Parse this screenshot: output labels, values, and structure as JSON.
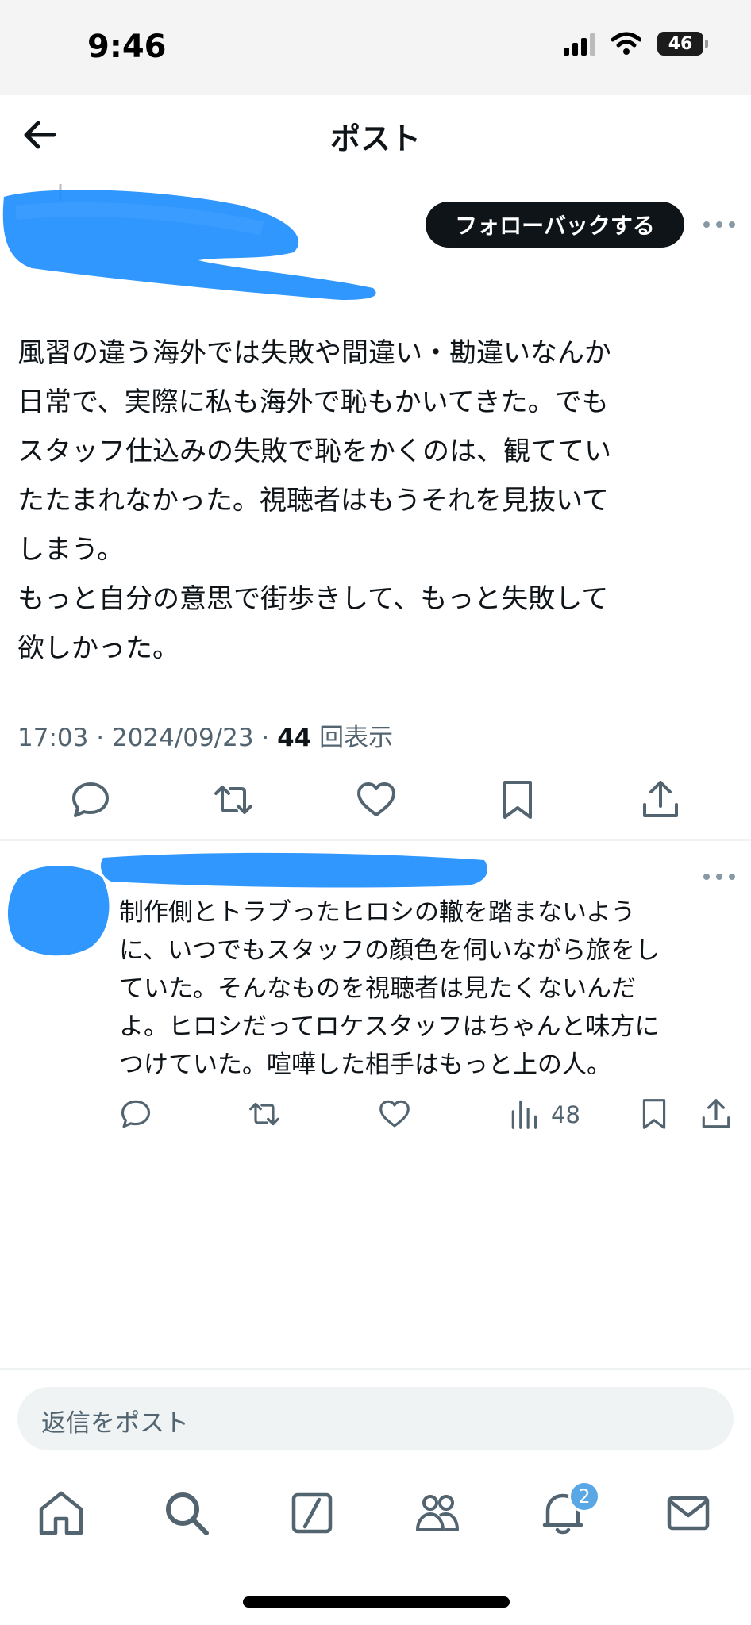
{
  "status_bar": {
    "time": "9:46",
    "battery": "46"
  },
  "header": {
    "title": "ポスト"
  },
  "post": {
    "follow_label": "フォローバックする",
    "text": "風習の違う海外では失敗や間違い・勘違いなんか\n日常で、実際に私も海外で恥もかいてきた。でも\nスタッフ仕込みの失敗で恥をかくのは、観ててい\nたたまれなかった。視聴者はもうそれを見抜いて\nしまう。\nもっと自分の意思で街歩きして、もっと失敗して\n欲しかった。",
    "time": "17:03 · 2024/09/23 · ",
    "views_count": "44",
    "views_label": " 回表示"
  },
  "reply": {
    "text": "制作側とトラブったヒロシの轍を踏まないよう\nに、いつでもスタッフの顔色を伺いながら旅をし\nていた。そんなものを視聴者は見たくないんだ\nよ。ヒロシだってロケスタッフはちゃんと味方に\nつけていた。喧嘩した相手はもっと上の人。",
    "views": "48"
  },
  "composer": {
    "placeholder": "返信をポスト"
  },
  "nav": {
    "notification_badge": "2"
  },
  "colors": {
    "blur": "#1a8cff",
    "icon": "#536471",
    "badge": "#5aa7e6"
  }
}
